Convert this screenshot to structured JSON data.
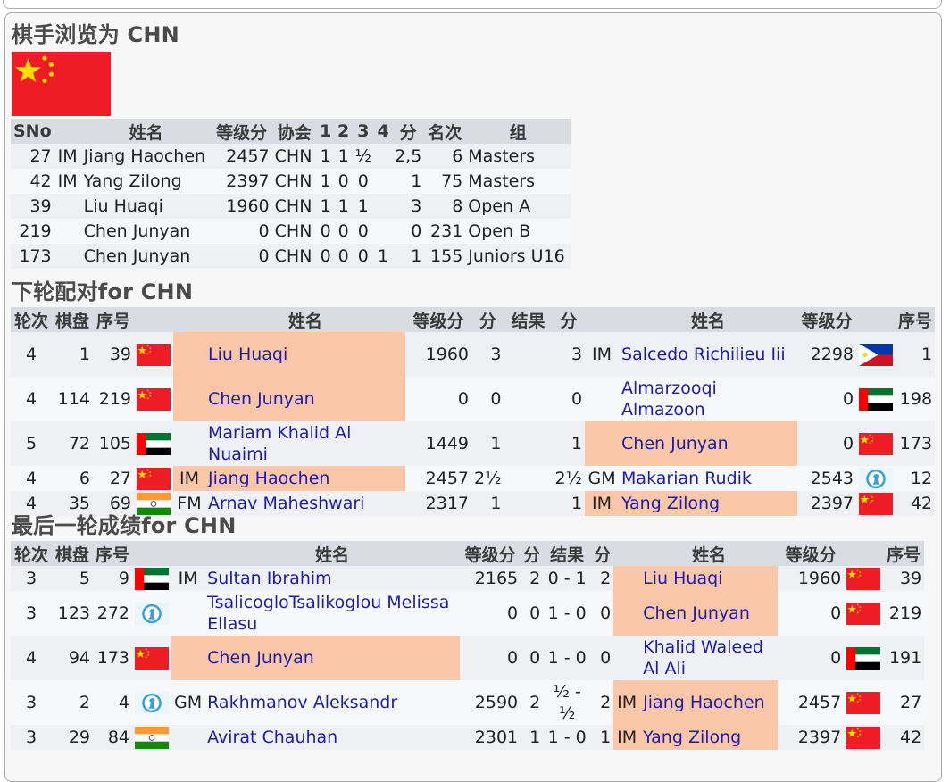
{
  "header": {
    "title": "棋手浏览为 CHN"
  },
  "country_flag_icon": "china-flag",
  "player_table": {
    "columns": [
      "SNo",
      "",
      "姓名",
      "等级分",
      "协会",
      "1",
      "2",
      "3",
      "4",
      "分",
      "名次",
      "组"
    ],
    "rows": [
      {
        "sno": "27",
        "title": "IM",
        "name": "Jiang Haochen",
        "rating": "2457",
        "fed": "CHN",
        "r1": "1",
        "r2": "1",
        "r3": "½",
        "r4": "",
        "pts": "2,5",
        "rank": "6",
        "group": "Masters"
      },
      {
        "sno": "42",
        "title": "IM",
        "name": "Yang Zilong",
        "rating": "2397",
        "fed": "CHN",
        "r1": "1",
        "r2": "0",
        "r3": "0",
        "r4": "",
        "pts": "1",
        "rank": "75",
        "group": "Masters"
      },
      {
        "sno": "39",
        "title": "",
        "name": "Liu Huaqi",
        "rating": "1960",
        "fed": "CHN",
        "r1": "1",
        "r2": "1",
        "r3": "1",
        "r4": "",
        "pts": "3",
        "rank": "8",
        "group": "Open A"
      },
      {
        "sno": "219",
        "title": "",
        "name": "Chen Junyan",
        "rating": "0",
        "fed": "CHN",
        "r1": "0",
        "r2": "0",
        "r3": "0",
        "r4": "",
        "pts": "0",
        "rank": "231",
        "group": "Open B"
      },
      {
        "sno": "173",
        "title": "",
        "name": "Chen Junyan",
        "rating": "0",
        "fed": "CHN",
        "r1": "0",
        "r2": "0",
        "r3": "0",
        "r4": "1",
        "pts": "1",
        "rank": "155",
        "group": "Juniors U16"
      }
    ]
  },
  "next_round": {
    "title": "下轮配对for CHN",
    "columns": [
      "轮次",
      "棋盘",
      "序号",
      "",
      "",
      "姓名",
      "等级分",
      "分",
      "结果",
      "分",
      "",
      "姓名",
      "等级分",
      "",
      "序号"
    ],
    "rows": [
      {
        "round": "4",
        "board": "1",
        "sno1": "39",
        "flag1": "china-flag",
        "title1": "",
        "name1": "Liu Huaqi",
        "rating1": "1960",
        "pts1": "3",
        "result": "",
        "pts2": "3",
        "title2": "IM",
        "name2": "Salcedo Richilieu Iii",
        "rating2": "2298",
        "flag2": "philippines-flag",
        "sno2": "1",
        "hl": 1
      },
      {
        "round": "4",
        "board": "114",
        "sno1": "219",
        "flag1": "china-flag",
        "title1": "",
        "name1": "Chen Junyan",
        "rating1": "0",
        "pts1": "0",
        "result": "",
        "pts2": "0",
        "title2": "",
        "name2": "Almarzooqi Almazoon",
        "rating2": "0",
        "flag2": "uae-flag",
        "sno2": "198",
        "hl": 1
      },
      {
        "round": "5",
        "board": "72",
        "sno1": "105",
        "flag1": "uae-flag",
        "title1": "",
        "name1": "Mariam Khalid Al Nuaimi",
        "rating1": "1449",
        "pts1": "1",
        "result": "",
        "pts2": "1",
        "title2": "",
        "name2": "Chen Junyan",
        "rating2": "0",
        "flag2": "china-flag",
        "sno2": "173",
        "hl": 2
      },
      {
        "round": "4",
        "board": "6",
        "sno1": "27",
        "flag1": "china-flag",
        "title1": "IM",
        "name1": "Jiang Haochen",
        "rating1": "2457",
        "pts1": "2½",
        "result": "",
        "pts2": "2½",
        "title2": "GM",
        "name2": "Makarian Rudik",
        "rating2": "2543",
        "flag2": "fide-flag",
        "sno2": "12",
        "hl": 1
      },
      {
        "round": "4",
        "board": "35",
        "sno1": "69",
        "flag1": "india-flag",
        "title1": "FM",
        "name1": "Arnav Maheshwari",
        "rating1": "2317",
        "pts1": "1",
        "result": "",
        "pts2": "1",
        "title2": "IM",
        "name2": "Yang Zilong",
        "rating2": "2397",
        "flag2": "china-flag",
        "sno2": "42",
        "hl": 2
      }
    ]
  },
  "last_round": {
    "title": "最后一轮成绩for CHN",
    "columns": [
      "轮次",
      "棋盘",
      "序号",
      "",
      "",
      "姓名",
      "等级分",
      "分",
      "结果",
      "分",
      "",
      "姓名",
      "等级分",
      "",
      "序号"
    ],
    "rows": [
      {
        "round": "3",
        "board": "5",
        "sno1": "9",
        "flag1": "uae-flag",
        "title1": "IM",
        "name1": "Sultan Ibrahim",
        "rating1": "2165",
        "pts1": "2",
        "result": "0 - 1",
        "pts2": "2",
        "title2": "",
        "name2": "Liu Huaqi",
        "rating2": "1960",
        "flag2": "china-flag",
        "sno2": "39",
        "hl": 2
      },
      {
        "round": "3",
        "board": "123",
        "sno1": "272",
        "flag1": "fide-flag",
        "title1": "",
        "name1": "TsalicogloTsalikoglou Melissa Ellasu",
        "rating1": "0",
        "pts1": "0",
        "result": "1 - 0",
        "pts2": "0",
        "title2": "",
        "name2": "Chen Junyan",
        "rating2": "0",
        "flag2": "china-flag",
        "sno2": "219",
        "hl": 2
      },
      {
        "round": "4",
        "board": "94",
        "sno1": "173",
        "flag1": "china-flag",
        "title1": "",
        "name1": "Chen Junyan",
        "rating1": "0",
        "pts1": "0",
        "result": "1 - 0",
        "pts2": "0",
        "title2": "",
        "name2": "Khalid Waleed Al Ali",
        "rating2": "0",
        "flag2": "uae-flag",
        "sno2": "191",
        "hl": 1
      },
      {
        "round": "3",
        "board": "2",
        "sno1": "4",
        "flag1": "fide-flag",
        "title1": "GM",
        "name1": "Rakhmanov Aleksandr",
        "rating1": "2590",
        "pts1": "2",
        "result": "½ - ½",
        "pts2": "2",
        "title2": "IM",
        "name2": "Jiang Haochen",
        "rating2": "2457",
        "flag2": "china-flag",
        "sno2": "27",
        "hl": 2
      },
      {
        "round": "3",
        "board": "29",
        "sno1": "84",
        "flag1": "india-flag",
        "title1": "",
        "name1": "Avirat Chauhan",
        "rating1": "2301",
        "pts1": "1",
        "result": "1 - 0",
        "pts2": "1",
        "title2": "IM",
        "name2": "Yang Zilong",
        "rating2": "2397",
        "flag2": "china-flag",
        "sno2": "42",
        "hl": 2
      }
    ]
  },
  "colors": {
    "highlight": "#fac8a8",
    "header_bg": "#d9dce2",
    "link": "#1c1cb0",
    "heading": "#4a4a4a"
  }
}
